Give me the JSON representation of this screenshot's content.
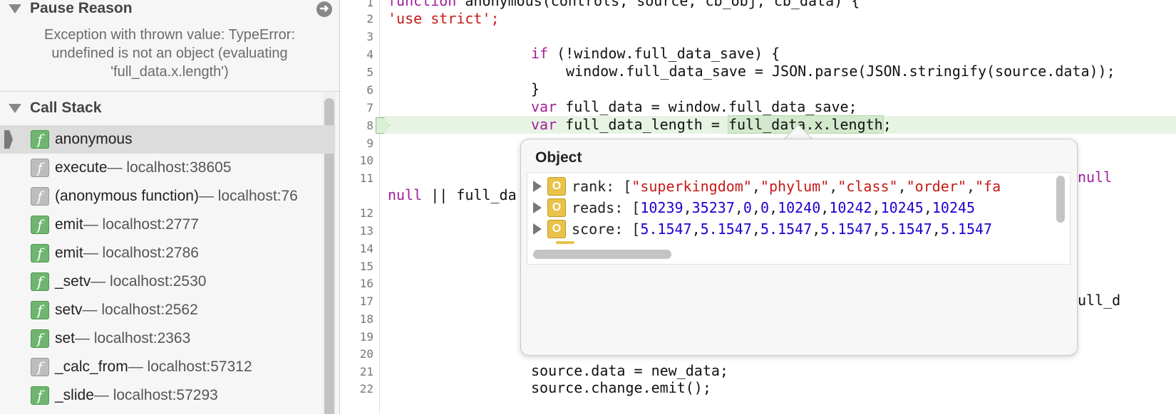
{
  "pause": {
    "title": "Pause Reason",
    "message_l1": "Exception with thrown value: TypeError:",
    "message_l2": "undefined is not an object (evaluating",
    "message_l3": "'full_data.x.length')"
  },
  "stack": {
    "title": "Call Stack",
    "frames": [
      {
        "name": "anonymous",
        "location": "",
        "icon": "green"
      },
      {
        "name": "execute",
        "location": " — localhost:38605",
        "icon": "gray"
      },
      {
        "name": "(anonymous function)",
        "location": " — localhost:76",
        "icon": "gray"
      },
      {
        "name": "emit",
        "location": " — localhost:2777",
        "icon": "green"
      },
      {
        "name": "emit",
        "location": " — localhost:2786",
        "icon": "green"
      },
      {
        "name": "_setv",
        "location": " — localhost:2530",
        "icon": "green"
      },
      {
        "name": "setv",
        "location": " — localhost:2562",
        "icon": "green"
      },
      {
        "name": "set",
        "location": " — localhost:2363",
        "icon": "green"
      },
      {
        "name": "_calc_from",
        "location": " — localhost:57312",
        "icon": "gray"
      },
      {
        "name": "_slide",
        "location": " — localhost:57293",
        "icon": "green"
      }
    ]
  },
  "editor": {
    "line_numbers": [
      "1",
      "2",
      "3",
      "4",
      "5",
      "6",
      "7",
      "8",
      "9",
      "10",
      "11",
      "12",
      "13",
      "14",
      "15",
      "16",
      "17",
      "18",
      "19",
      "20",
      "21",
      "22"
    ],
    "code": {
      "l1a": "function",
      "l1b": " anonymous(controls, source, cb_obj, cb_data) {",
      "l2": "'use strict';",
      "l4a": "if",
      "l4b": " (!window.full_data_save) {",
      "l5": "window.full_data_save = JSON.parse(JSON.stringify(source.data));",
      "l6": "}",
      "l7a": "var",
      "l7b": " full_data = window.full_data_save;",
      "l8a": "var",
      "l8b": " full_data_length = ",
      "l8c": "full_data.x.length",
      "l8d": ";",
      "l11a": "null",
      "l11b": " || full_da",
      "l11r": "null",
      "l17r": "ull_d",
      "l21": "source.data = new_data;",
      "l22": "source.change.emit();"
    }
  },
  "popover": {
    "title": "Object",
    "props": [
      {
        "key": "rank",
        "values": [
          "\"superkingdom\"",
          "\"phylum\"",
          "\"class\"",
          "\"order\"",
          "\"fa"
        ]
      },
      {
        "key": "reads",
        "values": [
          "10239",
          "35237",
          "0",
          "0",
          "10240",
          "10242",
          "10245",
          "10245"
        ]
      },
      {
        "key": "score",
        "values": [
          "5.1547",
          "5.1547",
          "5.1547",
          "5.1547",
          "5.1547",
          "5.1547"
        ]
      }
    ]
  }
}
